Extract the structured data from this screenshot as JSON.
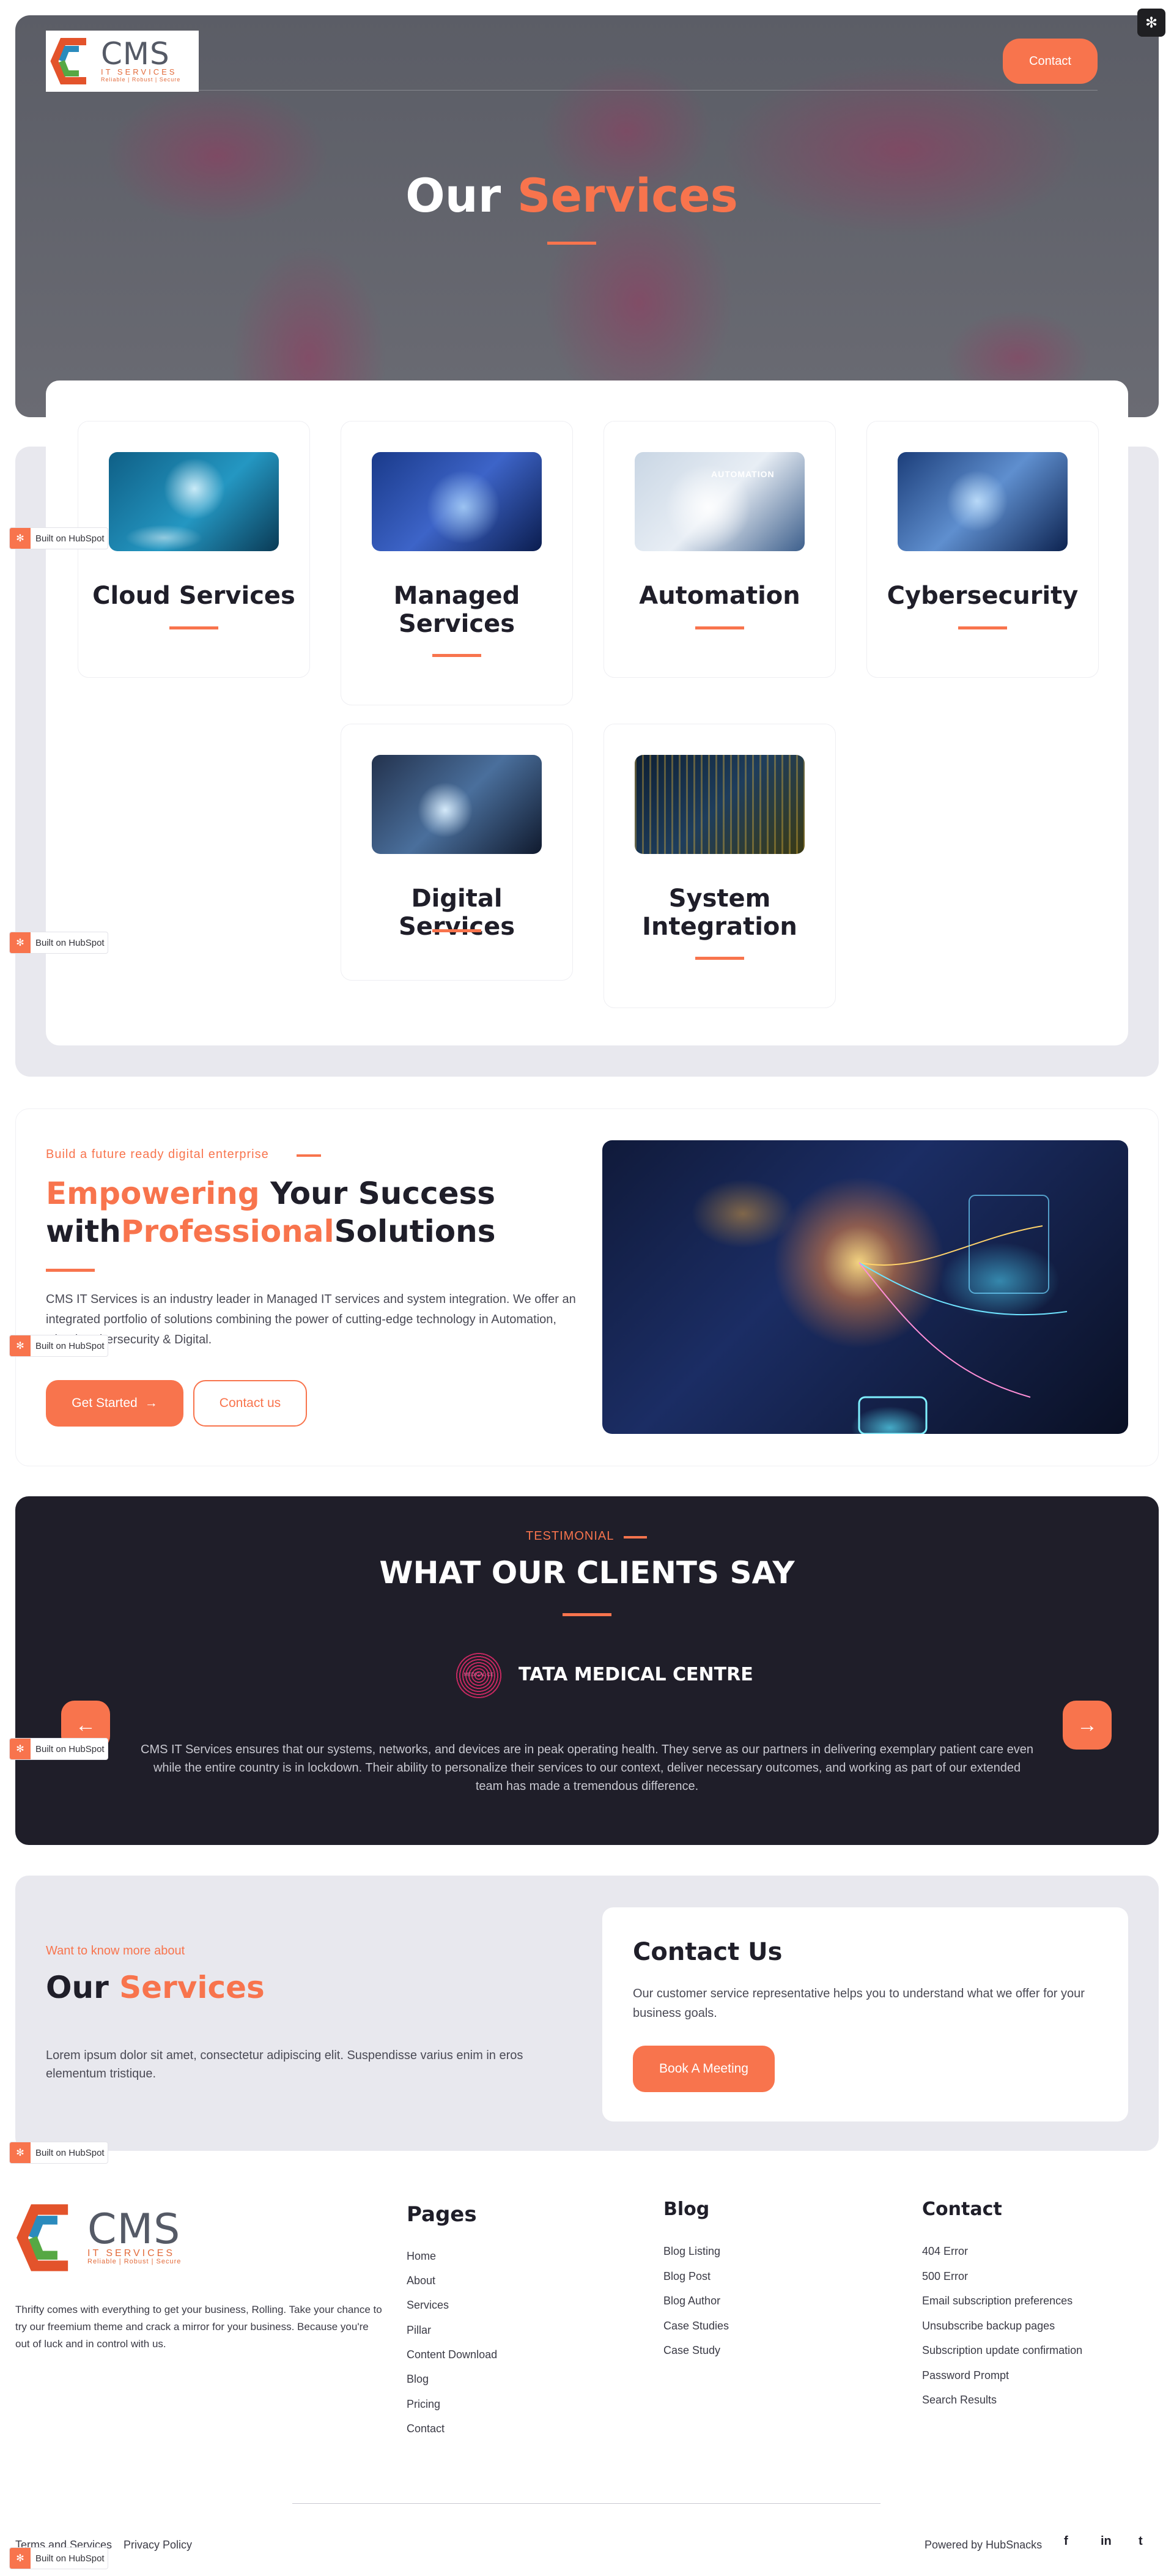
{
  "hero": {
    "logo": {
      "name": "CMS",
      "sub": "IT SERVICES",
      "tagline": "Reliable | Robust | Secure"
    },
    "contact_label": "Contact",
    "title_part1": "Our ",
    "title_part2": "Services",
    "hubspot_icon": "hubspot-sprocket-icon"
  },
  "services": [
    {
      "title": "Cloud Services"
    },
    {
      "title": "Managed Services"
    },
    {
      "title": "Automation",
      "image_caption": "AUTOMATION"
    },
    {
      "title": "Cybersecurity"
    },
    {
      "title": "Digital Services"
    },
    {
      "title": "System Integration"
    }
  ],
  "hubspot_badge": "Built on HubSpot",
  "about": {
    "eyebrow": "Build a future ready digital enterprise",
    "title_a": "Empowering",
    "title_b": " Your Success",
    "title_c": "with",
    "title_d": "Professional",
    "title_e": "Solutions",
    "body": "CMS IT Services is an industry leader in Managed IT services and system integration. We offer an integrated portfolio of solutions combining the power of cutting-edge technology in Automation, Cloud, Cybersecurity & Digital.",
    "primary_btn": "Get Started",
    "primary_btn_icon": "arrow-right-icon",
    "secondary_btn": "Contact us"
  },
  "testimonial": {
    "eyebrow": "TESTIMONIAL",
    "title": "WHAT OUR CLIENTS SAY",
    "logo_text": "MEDICAL CE",
    "company": "TATA MEDICAL CENTRE",
    "quote": "CMS IT Services ensures that our systems, networks, and devices are in peak operating health. They serve as our partners in delivering exemplary patient care even while the entire country is in lockdown. Their ability to personalize their services to our context, deliver necessary outcomes, and working as part of our extended team has made a tremendous difference.",
    "prev_icon": "arrow-left-icon",
    "next_icon": "arrow-right-icon"
  },
  "cta": {
    "eyebrow": "Want to know more about",
    "title_a": "Our ",
    "title_b": "Services",
    "body": "Lorem ipsum dolor sit amet, consectetur adipiscing elit. Suspendisse varius enim in eros elementum tristique.",
    "card_title": "Contact Us",
    "card_body": "Our customer service representative helps you to understand what we offer for your business goals.",
    "card_btn": "Book A Meeting"
  },
  "footer": {
    "description": "Thrifty comes with everything to get your business, Rolling. Take your chance to try our freemium theme and crack a mirror for your business. Because you're out of luck and in control with us.",
    "pages": {
      "heading": "Pages",
      "links": [
        "Home",
        "About",
        "Services",
        "Pillar",
        "Content Download",
        "Blog",
        "Pricing",
        "Contact"
      ]
    },
    "blog": {
      "heading": "Blog",
      "links": [
        "Blog Listing",
        "Blog Post",
        "Blog Author",
        "Case Studies",
        "Case Study"
      ]
    },
    "contact": {
      "heading": "Contact",
      "links": [
        "404 Error",
        "500 Error",
        "Email subscription preferences",
        "Unsubscribe backup pages",
        "Subscription update confirmation",
        "Password Prompt",
        "Search Results"
      ]
    },
    "terms": "Terms and Services",
    "privacy": "Privacy Policy",
    "powered": "Powered by HubSnacks",
    "social": [
      "f",
      "in",
      "t"
    ],
    "social_icons": [
      "facebook-icon",
      "linkedin-icon",
      "twitter-icon"
    ]
  },
  "colors": {
    "accent": "#f8744d",
    "dark": "#1f1e29",
    "panel": "#e8e8ee"
  }
}
